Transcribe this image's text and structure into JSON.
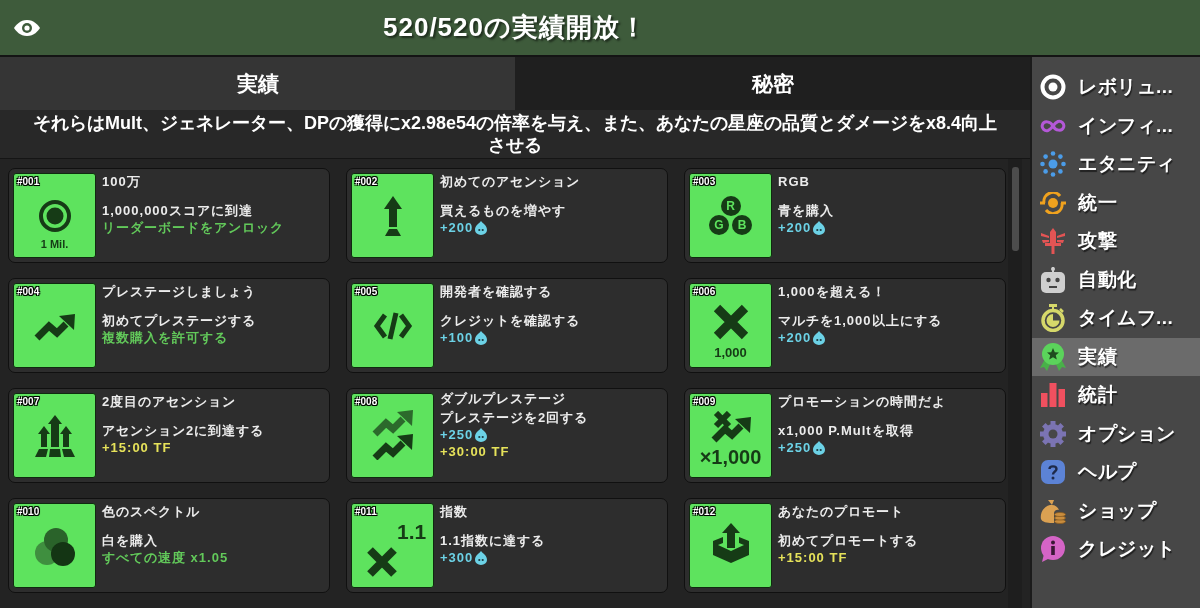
{
  "header": {
    "title": "520/520の実績開放！"
  },
  "tabs": [
    {
      "label": "実績",
      "selected": true
    },
    {
      "label": "秘密",
      "selected": false
    }
  ],
  "description": "それらはMult、ジェネレーター、DPの獲得にx2.98e54の倍率を与え、また、あなたの星座の品質とダメージをx8.4向上させる",
  "achievements": [
    {
      "number": "#001",
      "title": "100万",
      "description": "1,000,000スコアに到達",
      "tile_text": [
        "1 Mil."
      ],
      "rewards": [
        {
          "kind": "unlock",
          "text": "リーダーボードをアンロック"
        }
      ]
    },
    {
      "number": "#002",
      "title": "初めてのアセンション",
      "description": "買えるものを増やす",
      "rewards": [
        {
          "kind": "credits",
          "text": "+200"
        }
      ]
    },
    {
      "number": "#003",
      "title": "RGB",
      "description": "青を購入",
      "tile_text": [
        "R",
        "G",
        "B"
      ],
      "rewards": [
        {
          "kind": "credits",
          "text": "+200"
        }
      ]
    },
    {
      "number": "#004",
      "title": "プレステージしましょう",
      "description": "初めてプレステージする",
      "rewards": [
        {
          "kind": "unlock",
          "text": "複数購入を許可する"
        }
      ]
    },
    {
      "number": "#005",
      "title": "開発者を確認する",
      "description": "クレジットを確認する",
      "rewards": [
        {
          "kind": "credits",
          "text": "+100"
        }
      ]
    },
    {
      "number": "#006",
      "title": "1,000を超える！",
      "description": "マルチを1,000以上にする",
      "tile_text": [
        "1,000"
      ],
      "rewards": [
        {
          "kind": "credits",
          "text": "+200"
        }
      ]
    },
    {
      "number": "#007",
      "title": "2度目のアセンション",
      "description": "アセンション2に到達する",
      "rewards": [
        {
          "kind": "time",
          "text": "+15:00 TF"
        }
      ]
    },
    {
      "number": "#008",
      "title": "ダブルプレステージ",
      "description": "プレステージを2回する",
      "rewards": [
        {
          "kind": "credits",
          "text": "+250"
        },
        {
          "kind": "time",
          "text": "+30:00 TF"
        }
      ]
    },
    {
      "number": "#009",
      "title": "プロモーションの時間だよ",
      "description": "x1,000 P.Multを取得",
      "tile_text": [
        "×1,000"
      ],
      "rewards": [
        {
          "kind": "credits",
          "text": "+250"
        }
      ]
    },
    {
      "number": "#010",
      "title": "色のスペクトル",
      "description": "白を購入",
      "rewards": [
        {
          "kind": "unlock",
          "text": "すべての速度 x1.05"
        }
      ]
    },
    {
      "number": "#011",
      "title": "指数",
      "description": "1.1指数に達する",
      "tile_text": [
        "1.1"
      ],
      "rewards": [
        {
          "kind": "credits",
          "text": "+300"
        }
      ]
    },
    {
      "number": "#012",
      "title": "あなたのプロモート",
      "description": "初めてプロモートする",
      "rewards": [
        {
          "kind": "time",
          "text": "+15:00 TF"
        }
      ]
    }
  ],
  "sidebar": {
    "items": [
      {
        "label": "レボリュ...",
        "selected": false
      },
      {
        "label": "インフィ...",
        "selected": false
      },
      {
        "label": "エタニティ",
        "selected": false
      },
      {
        "label": "統一",
        "selected": false
      },
      {
        "label": "攻撃",
        "selected": false
      },
      {
        "label": "自動化",
        "selected": false
      },
      {
        "label": "タイムフ...",
        "selected": false
      },
      {
        "label": "実績",
        "selected": true
      },
      {
        "label": "統計",
        "selected": false
      },
      {
        "label": "オプション",
        "selected": false
      },
      {
        "label": "ヘルプ",
        "selected": false
      },
      {
        "label": "ショップ",
        "selected": false
      },
      {
        "label": "クレジット",
        "selected": false
      }
    ]
  }
}
